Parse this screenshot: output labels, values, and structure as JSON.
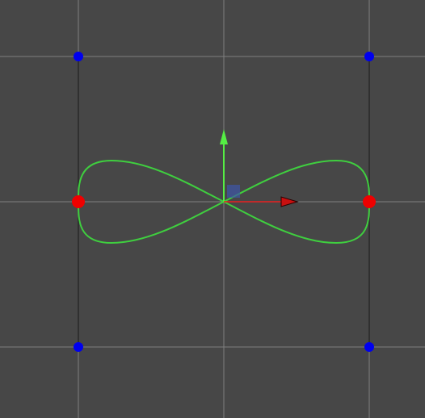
{
  "colors": {
    "background": "#474747",
    "grid_line": "#7f7f7f",
    "guide_line": "#1a1a1a",
    "curve": "#3fcf3f",
    "anchor_point": "#ee0000",
    "control_point": "#0000ee",
    "axis_x": "#e82020",
    "axis_y": "#55ee44",
    "origin_handle": "#3d56a8"
  },
  "icons": {
    "origin": "origin-handle-icon",
    "x_axis": "x-axis-arrow-icon",
    "y_axis": "y-axis-arrow-icon"
  }
}
